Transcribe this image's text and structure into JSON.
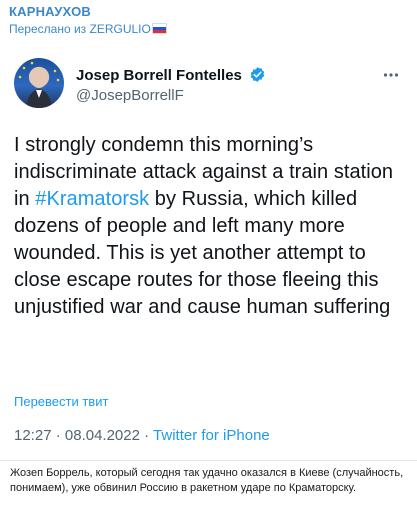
{
  "header": {
    "channel_name": "КАРНАУХОВ",
    "forwarded_from": "Переслано из ZERGULIO"
  },
  "tweet": {
    "author_name": "Josep Borrell Fontelles",
    "author_handle": "@JosepBorrellF",
    "text_before_hashtag": "I strongly condemn this morning’s indiscriminate attack against a train station in ",
    "hashtag": "#Kramatorsk",
    "text_after_hashtag": " by Russia, which  killed dozens of people and left many more wounded. This is yet another attempt to close escape routes for those fleeing this unjustified war and cause human suffering",
    "translate_label": "Перевести твит",
    "time": "12:27",
    "date": "08.04.2022",
    "separator": "·",
    "source": "Twitter for iPhone"
  },
  "caption": "Жозеп Боррель, который сегодня так удачно оказался в Киеве (случайность, понимаем), уже обвинил Россию в ракетном ударе по Краматорску.",
  "colors": {
    "channel": "#3b88c8",
    "link": "#1d9bf0",
    "muted": "#536471"
  }
}
